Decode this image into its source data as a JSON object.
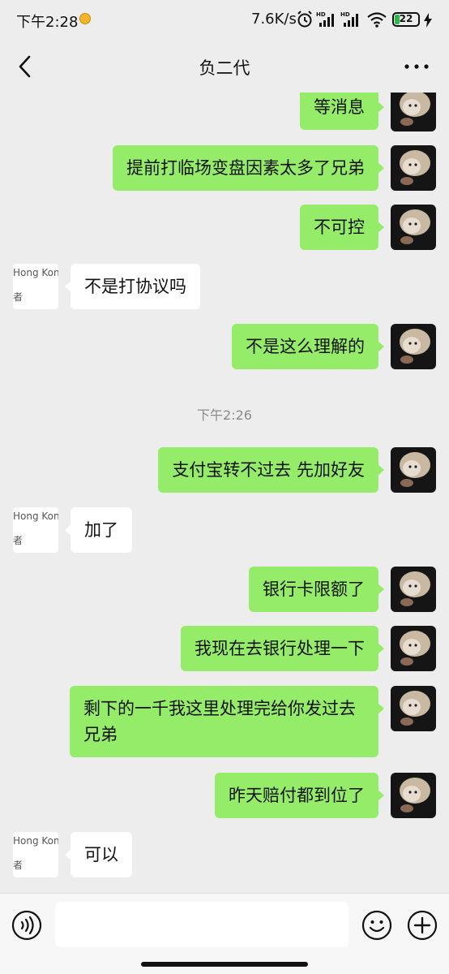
{
  "status_bar": {
    "time": "下午2:28",
    "net_speed": "7.6K/s",
    "battery": "22",
    "battery_level": 0.22
  },
  "header": {
    "title": "负二代"
  },
  "messages": [
    {
      "from": "me",
      "text": "等消息"
    },
    {
      "from": "me",
      "text": "提前打临场变盘因素太多了兄弟"
    },
    {
      "from": "me",
      "text": "不可控"
    },
    {
      "from": "other",
      "text": "不是打协议吗"
    },
    {
      "from": "me",
      "text": "不是这么理解的"
    },
    {
      "type": "time",
      "text": "下午2:26"
    },
    {
      "from": "me",
      "text": "支付宝转不过去 先加好友"
    },
    {
      "from": "other",
      "text": "加了"
    },
    {
      "from": "me",
      "text": "银行卡限额了"
    },
    {
      "from": "me",
      "text": "我现在去银行处理一下"
    },
    {
      "from": "me",
      "text": "剩下的一千我这里处理完给你发过去兄弟"
    },
    {
      "from": "me",
      "text": "昨天赔付都到位了"
    },
    {
      "from": "other",
      "text": "可以"
    }
  ],
  "other_avatar": {
    "line1": "Hong Kong",
    "line2": "者"
  },
  "input": {
    "value": ""
  },
  "colors": {
    "background": "#ededed",
    "my_bubble": "#95ec69",
    "other_bubble": "#ffffff",
    "battery": "#2db84c"
  },
  "icons": {
    "back": "chevron-left-icon",
    "more": "more-dots-icon",
    "voice": "voice-icon",
    "emoji": "emoji-icon",
    "plus": "plus-icon"
  }
}
